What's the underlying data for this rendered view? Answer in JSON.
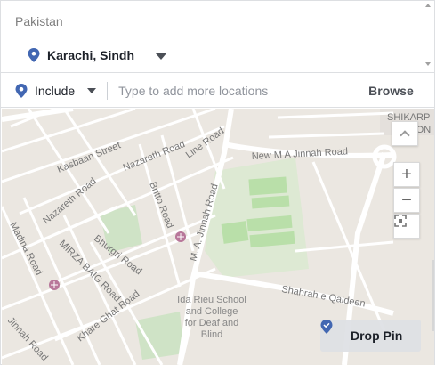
{
  "selected_locations": {
    "country": "Pakistan",
    "location": {
      "name": "Karachi, Sindh",
      "icon": "location-pin-icon"
    }
  },
  "search": {
    "include_label": "Include",
    "placeholder": "Type to add more locations",
    "browse_label": "Browse"
  },
  "map": {
    "street_labels": [
      "Kasbaan Street",
      "Nazareth Road",
      "Line Road",
      "New M A Jinnah Road",
      "Nazareth Road",
      "Britto Road",
      "M. A. Jinnah Road",
      "Madina Road",
      "Bhurgri Road",
      "MIRZA BAIG Road",
      "Khare Ghat Road",
      "Jinnah Road",
      "Shahrah e Qaideen",
      "SHIKARP",
      "OLON"
    ],
    "poi_label": [
      "Ida Rieu School",
      "and College",
      "for Deaf and",
      "Blind"
    ],
    "controls": {
      "plus": "+",
      "minus": "−"
    },
    "drop_pin_label": "Drop Pin"
  },
  "colors": {
    "pin": "#4267b2",
    "map_background": "#ebe7e1",
    "road": "#ffffff",
    "park": "#c8e2c0",
    "label": "#777777"
  }
}
